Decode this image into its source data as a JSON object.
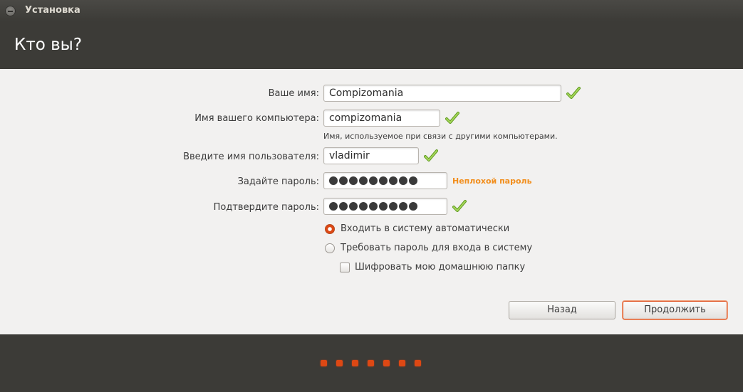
{
  "window": {
    "title": "Установка"
  },
  "page": {
    "title": "Кто вы?"
  },
  "form": {
    "name_label": "Ваше имя:",
    "name_value": "Compizomania",
    "computer_label": "Имя вашего компьютера:",
    "computer_value": "compizomania",
    "computer_hint": "Имя, используемое при связи с другими компьютерами.",
    "username_label": "Введите имя пользователя:",
    "username_value": "vladimir",
    "password_label": "Задайте пароль:",
    "password_length": 9,
    "password_strength": "Неплохой пароль",
    "confirm_label": "Подтвердите пароль:",
    "confirm_length": 9
  },
  "options": {
    "auto_login_label": "Входить в систему автоматически",
    "auto_login_selected": true,
    "require_password_label": "Требовать пароль для входа в систему",
    "require_password_selected": false,
    "encrypt_home_label": "Шифровать мою домашнюю папку",
    "encrypt_home_checked": false
  },
  "buttons": {
    "back_label": "Назад",
    "continue_label": "Продолжить"
  },
  "progress": {
    "steps": 7
  },
  "colors": {
    "accent": "#dd4814",
    "strength": "#f28e1c",
    "check": "#7ab32e",
    "dark_bg": "#3c3b37",
    "content_bg": "#f2f1f0"
  },
  "icons": {
    "valid": "check-mark-icon",
    "close": "minus-circle-icon"
  }
}
